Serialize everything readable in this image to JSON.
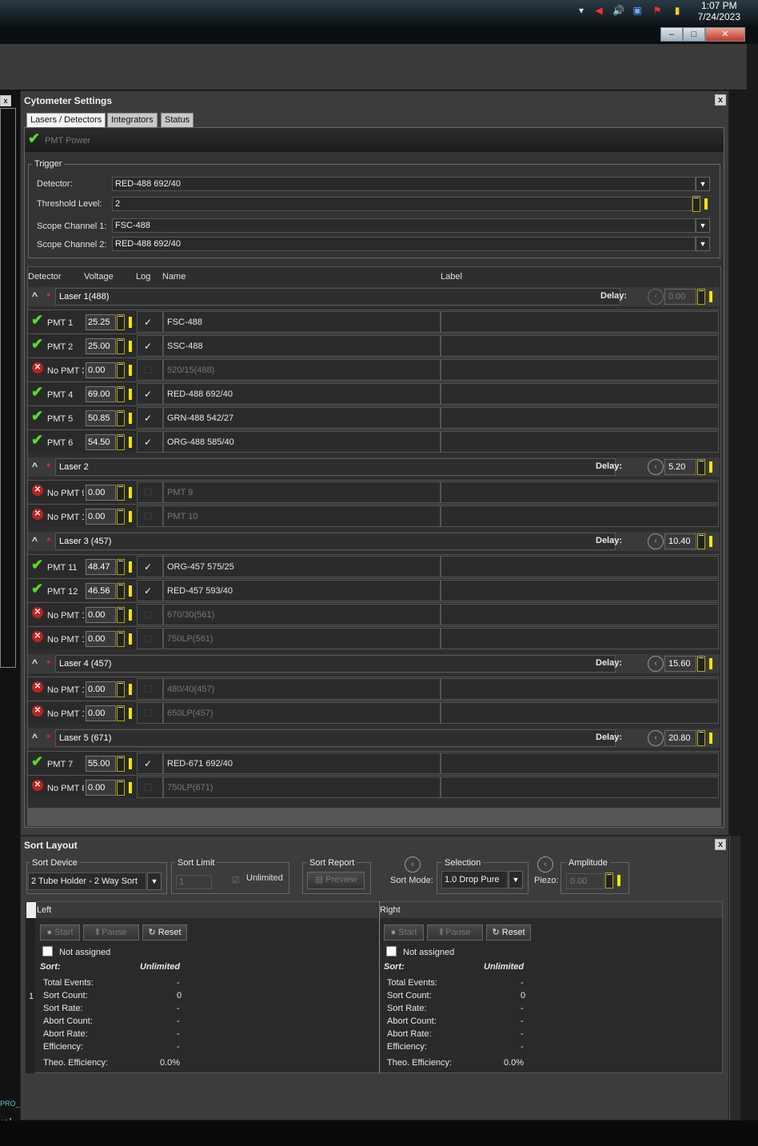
{
  "taskbar": {
    "time": "1:07 PM",
    "date": "7/24/2023"
  },
  "window_controls": {
    "minimize": "–",
    "maximize": "□",
    "close": "✕"
  },
  "cytometer": {
    "title": "Cytometer Settings",
    "close": "x",
    "tabs": [
      "Lasers / Detectors",
      "Integrators",
      "Status"
    ],
    "pmt_power": "PMT Power",
    "trigger": {
      "group": "Trigger",
      "detector_label": "Detector:",
      "detector_value": "RED-488 692/40",
      "threshold_label": "Threshold Level:",
      "threshold_value": "2",
      "scope1_label": "Scope Channel 1:",
      "scope1_value": "FSC-488",
      "scope2_label": "Scope Channel 2:",
      "scope2_value": "RED-488 692/40"
    },
    "columns": {
      "detector": "Detector",
      "voltage": "Voltage",
      "log": "Log",
      "name": "Name",
      "label": "Label"
    },
    "delay_label": "Delay:",
    "lasers": [
      {
        "name": "Laser 1(488)",
        "delay": "0.00",
        "delay_enabled": false,
        "pmts": [
          {
            "status": "ok",
            "pmt": "PMT 1",
            "voltage": "25.25",
            "log": true,
            "name": "FSC-488"
          },
          {
            "status": "ok",
            "pmt": "PMT 2",
            "voltage": "25.00",
            "log": true,
            "name": "SSC-488"
          },
          {
            "status": "none",
            "pmt": "No PMT 3",
            "voltage": "0.00",
            "log": false,
            "name": "520/15(488)"
          },
          {
            "status": "ok",
            "pmt": "PMT 4",
            "voltage": "69.00",
            "log": true,
            "name": "RED-488 692/40"
          },
          {
            "status": "ok",
            "pmt": "PMT 5",
            "voltage": "50.85",
            "log": true,
            "name": "GRN-488 542/27"
          },
          {
            "status": "ok",
            "pmt": "PMT 6",
            "voltage": "54.50",
            "log": true,
            "name": "ORG-488 585/40"
          }
        ]
      },
      {
        "name": "Laser 2",
        "delay": "5.20",
        "delay_enabled": true,
        "pmts": [
          {
            "status": "none",
            "pmt": "No PMT 9",
            "voltage": "0.00",
            "log": false,
            "name": "PMT 9"
          },
          {
            "status": "none",
            "pmt": "No PMT 10",
            "voltage": "0.00",
            "log": false,
            "name": "PMT 10"
          }
        ]
      },
      {
        "name": "Laser 3 (457)",
        "delay": "10.40",
        "delay_enabled": true,
        "pmts": [
          {
            "status": "ok",
            "pmt": "PMT 11",
            "voltage": "48.47",
            "log": true,
            "name": "ORG-457 575/25"
          },
          {
            "status": "ok",
            "pmt": "PMT 12",
            "voltage": "46.56",
            "log": true,
            "name": "RED-457 593/40"
          },
          {
            "status": "none",
            "pmt": "No PMT 13",
            "voltage": "0.00",
            "log": false,
            "name": "670/30(561)"
          },
          {
            "status": "none",
            "pmt": "No PMT 14",
            "voltage": "0.00",
            "log": false,
            "name": "750LP(561)"
          }
        ]
      },
      {
        "name": "Laser 4 (457)",
        "delay": "15.60",
        "delay_enabled": true,
        "pmts": [
          {
            "status": "none",
            "pmt": "No PMT 15",
            "voltage": "0.00",
            "log": false,
            "name": "480/40(457)"
          },
          {
            "status": "none",
            "pmt": "No PMT 16",
            "voltage": "0.00",
            "log": false,
            "name": "650LP(457)"
          }
        ]
      },
      {
        "name": "Laser 5 (671)",
        "delay": "20.80",
        "delay_enabled": true,
        "pmts": [
          {
            "status": "ok",
            "pmt": "PMT 7",
            "voltage": "55.00",
            "log": true,
            "name": "RED-671 692/40"
          },
          {
            "status": "none",
            "pmt": "No PMT 8",
            "voltage": "0.00",
            "log": false,
            "name": "750LP(671)"
          }
        ]
      }
    ]
  },
  "sort": {
    "title": "Sort Layout",
    "close": "x",
    "device_group": "Sort Device",
    "device_value": "2 Tube Holder - 2 Way Sort",
    "limit_group": "Sort Limit",
    "limit_value": "1",
    "limit_unlimited": "Unlimited",
    "report_group": "Sort Report",
    "preview": "Preview",
    "sort_mode": "Sort Mode:",
    "selection_group": "Selection",
    "selection_value": "1.0 Drop Pure",
    "piezo": "Piezo:",
    "amplitude_group": "Amplitude",
    "amplitude_value": "0.00",
    "row_index": "1",
    "sides": [
      {
        "title": "Left",
        "start": "Start",
        "pause": "Pause",
        "reset": "Reset",
        "not_assigned": "Not assigned",
        "sort_label": "Sort:",
        "sort_value": "Unlimited",
        "stats": [
          [
            "Total Events:",
            "-"
          ],
          [
            "Sort Count:",
            "0"
          ],
          [
            "Sort Rate:",
            "-"
          ],
          [
            "Abort Count:",
            "-"
          ],
          [
            "Abort Rate:",
            "-"
          ],
          [
            "Efficiency:",
            "-"
          ]
        ],
        "theo_label": "Theo. Efficiency:",
        "theo_value": "0.0%"
      },
      {
        "title": "Right",
        "start": "Start",
        "pause": "Pause",
        "reset": "Reset",
        "not_assigned": "Not assigned",
        "sort_label": "Sort:",
        "sort_value": "Unlimited",
        "stats": [
          [
            "Total Events:",
            "-"
          ],
          [
            "Sort Count:",
            "0"
          ],
          [
            "Sort Rate:",
            "-"
          ],
          [
            "Abort Count:",
            "-"
          ],
          [
            "Abort Rate:",
            "-"
          ],
          [
            "Efficiency:",
            "-"
          ]
        ],
        "theo_label": "Theo. Efficiency:",
        "theo_value": "0.0%"
      }
    ]
  },
  "left_pane": {
    "tick": "10",
    "tick_exp": "1",
    "label": "PRO_"
  },
  "colors": {
    "ok": "#5cdc2a",
    "error": "#b22222",
    "accent": "#f2e600"
  }
}
